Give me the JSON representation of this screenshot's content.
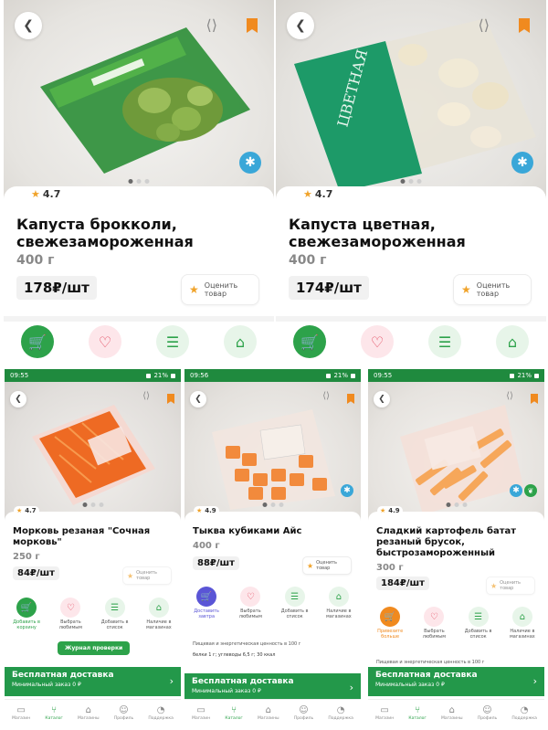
{
  "common": {
    "actions": {
      "cart_label": "Добавить в корзину",
      "favorite_label": "Выбрать любимым",
      "list_label": "Добавить в список",
      "stores_label": "Наличие в магазинах"
    },
    "rate_label": "Оценить товар",
    "delivery": {
      "title": "Бесплатная доставка",
      "subtitle": "Минимальный заказ",
      "amount": "0 ₽"
    },
    "tabs": [
      "Магазин",
      "Каталог",
      "Магазины",
      "Профиль",
      "Поддержка"
    ]
  },
  "products": [
    {
      "title": "Капуста брокколи, свежезамороженная",
      "weight": "400 г",
      "price": "178₽/шт",
      "rating": "4.7"
    },
    {
      "title": "Капуста цветная, свежезамороженная",
      "weight": "400 г",
      "price": "174₽/шт",
      "rating": "4.7"
    },
    {
      "title": "Морковь резаная \"Сочная морковь\"",
      "weight": "250 г",
      "price": "84₽/шт",
      "rating": "4.7",
      "time": "09:55",
      "battery": "21%",
      "journal_label": "Журнал проверки"
    },
    {
      "title": "Тыква кубиками Айс",
      "weight": "400 г",
      "price": "88₽/шт",
      "rating": "4.9",
      "time": "09:56",
      "battery": "21%",
      "cart_label": "Доставить завтра",
      "nutrition_heading": "Пищевая и энергетическая ценность в 100 г",
      "nutrition_values": "белки 1 г; углеводы 6,5 г; 30 ккал"
    },
    {
      "title": "Сладкий картофель батат резаный брусок, быстрозамороженный",
      "weight": "300 г",
      "price": "184₽/шт",
      "rating": "4.9",
      "time": "09:55",
      "battery": "21%",
      "cart_label": "Привезите больше",
      "nutrition_heading": "Пищевая и энергетическая ценность в 100 г"
    }
  ],
  "colors": {
    "brand_green": "#2da24a",
    "orange": "#f08a1f",
    "purple": "#5a55d6",
    "snow_blue": "#3aa7d8"
  }
}
